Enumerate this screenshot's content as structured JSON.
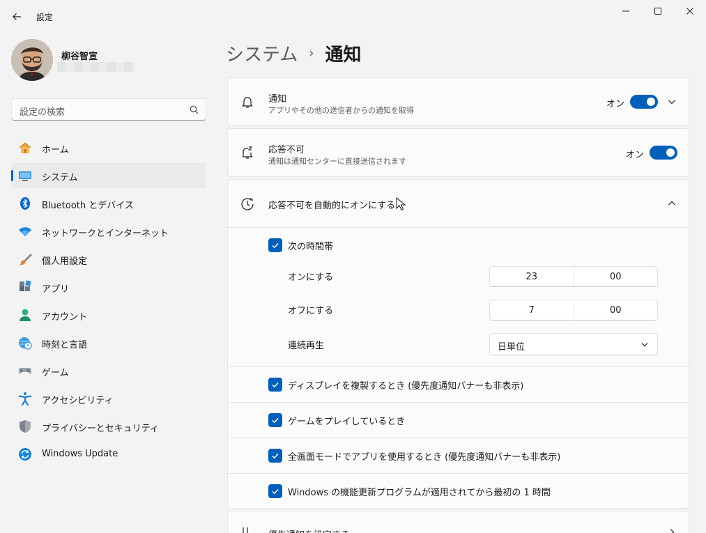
{
  "window": {
    "title": "設定",
    "icons": {
      "back": "back-arrow-icon",
      "minimize": "minimize-icon",
      "maximize": "maximize-icon",
      "close": "close-icon"
    }
  },
  "profile": {
    "name": "柳谷智宣"
  },
  "search": {
    "placeholder": "設定の検索",
    "icon": "search-icon"
  },
  "nav": {
    "items": [
      {
        "label": "ホーム",
        "icon": "home-icon",
        "active": false
      },
      {
        "label": "システム",
        "icon": "system-icon",
        "active": true
      },
      {
        "label": "Bluetooth とデバイス",
        "icon": "bluetooth-icon",
        "active": false
      },
      {
        "label": "ネットワークとインターネット",
        "icon": "wifi-icon",
        "active": false
      },
      {
        "label": "個人用設定",
        "icon": "brush-icon",
        "active": false
      },
      {
        "label": "アプリ",
        "icon": "apps-icon",
        "active": false
      },
      {
        "label": "アカウント",
        "icon": "account-icon",
        "active": false
      },
      {
        "label": "時刻と言語",
        "icon": "globe-clock-icon",
        "active": false
      },
      {
        "label": "ゲーム",
        "icon": "gamepad-icon",
        "active": false
      },
      {
        "label": "アクセシビリティ",
        "icon": "accessibility-icon",
        "active": false
      },
      {
        "label": "プライバシーとセキュリティ",
        "icon": "shield-icon",
        "active": false
      },
      {
        "label": "Windows Update",
        "icon": "update-icon",
        "active": false
      }
    ]
  },
  "breadcrumb": {
    "parent": "システム",
    "separator": "›",
    "current": "通知"
  },
  "notifications": {
    "title": "通知",
    "subtitle": "アプリやその他の送信者からの通知を取得",
    "toggle_label": "オン",
    "toggle_on": true
  },
  "dnd": {
    "title": "応答不可",
    "subtitle": "通知は通知センターに直接送信されます",
    "toggle_label": "オン",
    "toggle_on": true
  },
  "auto_dnd": {
    "title": "応答不可を自動的にオンにする",
    "schedule_label": "次の時間帯",
    "turn_on": {
      "label": "オンにする",
      "hour": "23",
      "minute": "00"
    },
    "turn_off": {
      "label": "オフにする",
      "hour": "7",
      "minute": "00"
    },
    "repeat": {
      "label": "連続再生",
      "value": "日単位"
    },
    "options": [
      "ディスプレイを複製するとき (優先度通知バナーも非表示)",
      "ゲームをプレイしているとき",
      "全画面モードでアプリを使用するとき (優先度通知バナーも非表示)",
      "Windows の機能更新プログラムが適用されてから最初の 1 時間"
    ]
  },
  "priority": {
    "title": "優先通知を設定する"
  },
  "colors": {
    "accent": "#005fb8",
    "background": "#f3f3f3",
    "card": "#fbfbfb"
  }
}
